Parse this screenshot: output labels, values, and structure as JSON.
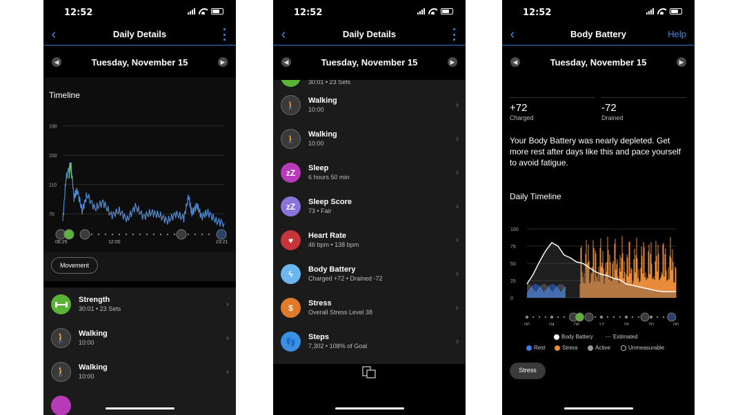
{
  "status": {
    "time": "12:52"
  },
  "screen1": {
    "title": "Daily Details",
    "date": "Tuesday, November 15",
    "section": "Timeline",
    "yticks": [
      "190",
      "150",
      "110",
      "70"
    ],
    "xticks": [
      "06:25",
      "12:00",
      "23:21"
    ],
    "movement_button": "Movement",
    "rows": [
      {
        "title": "Strength",
        "sub": "30:01 • 23 Sets"
      },
      {
        "title": "Walking",
        "sub": "10:00"
      },
      {
        "title": "Walking",
        "sub": "10:00"
      }
    ]
  },
  "screen2": {
    "title": "Daily Details",
    "date": "Tuesday, November 15",
    "partial_sub": "30:01 • 23 Sets",
    "rows": [
      {
        "title": "Walking",
        "sub": "10:00",
        "icon": "walking-icon",
        "color": "#3a3a3a"
      },
      {
        "title": "Walking",
        "sub": "10:00",
        "icon": "walking-icon",
        "color": "#3a3a3a"
      },
      {
        "title": "Sleep",
        "sub": "6 hours 50 min",
        "icon": "sleep-icon",
        "color": "#b83ab8"
      },
      {
        "title": "Sleep Score",
        "sub": "73 • Fair",
        "icon": "sleep-score-icon",
        "color": "#8a74d9"
      },
      {
        "title": "Heart Rate",
        "sub": "46 bpm • 138 bpm",
        "icon": "heart-icon",
        "color": "#c7343a"
      },
      {
        "title": "Body Battery",
        "sub": "Charged +72 • Drained -72",
        "icon": "body-battery-icon",
        "color": "#6cb6f0"
      },
      {
        "title": "Stress",
        "sub": "Overall Stress Level 38",
        "icon": "stress-icon",
        "color": "#e07b2c"
      },
      {
        "title": "Steps",
        "sub": "7,302 • 108% of Goal",
        "icon": "steps-icon",
        "color": "#3b8fe0"
      }
    ]
  },
  "screen3": {
    "title": "Body Battery",
    "help": "Help",
    "date": "Tuesday, November 15",
    "charged_value": "+72",
    "charged_label": "Charged",
    "drained_value": "-72",
    "drained_label": "Drained",
    "message": "Your Body Battery was nearly depleted. Get more rest after days like this and pace yourself to avoid fatigue.",
    "section": "Daily Timeline",
    "legend": {
      "body_battery": "Body Battery",
      "estimated": "Estimated",
      "rest": "Rest",
      "stress": "Stress",
      "active": "Active",
      "unmeasurable": "Unmeasurable"
    },
    "stress_button": "Stress"
  },
  "colors": {
    "accent": "#3d8ee8",
    "rest": "#3b7be0",
    "stress": "#e88b3a",
    "active": "#9a9a9a",
    "hr_line": "#4f8ddb",
    "hr_peak": "#6cc04a"
  },
  "chart_data": [
    {
      "type": "line",
      "title": "Timeline",
      "yticks": [
        70,
        110,
        150,
        190
      ],
      "ylim": [
        40,
        200
      ],
      "xticks": [
        "06:25",
        "12:00",
        "23:21"
      ],
      "series": [
        {
          "x": [
            0,
            0.02,
            0.05,
            0.07,
            0.09,
            0.12,
            0.15,
            0.2,
            0.25,
            0.3,
            0.35,
            0.4,
            0.45,
            0.5,
            0.55,
            0.6,
            0.65,
            0.7,
            0.75,
            0.78,
            0.8,
            0.83,
            0.86,
            0.9,
            0.95,
            1.0
          ],
          "values": [
            60,
            118,
            140,
            92,
            102,
            74,
            96,
            77,
            86,
            68,
            74,
            62,
            80,
            66,
            72,
            68,
            60,
            70,
            64,
            94,
            70,
            82,
            66,
            72,
            60,
            57
          ]
        }
      ]
    },
    {
      "type": "area",
      "title": "Daily Timeline",
      "yticks": [
        0,
        25,
        50,
        75,
        100
      ],
      "ylim": [
        0,
        100
      ],
      "xticks": [
        "00",
        "04",
        "08",
        "12",
        "16",
        "20",
        "00"
      ],
      "series": [
        {
          "name": "Body Battery",
          "x": [
            0,
            1,
            2,
            3,
            4,
            5,
            6,
            7,
            8,
            9,
            10,
            11,
            12,
            13,
            14,
            15,
            16,
            17,
            18,
            19,
            20,
            21,
            22,
            23,
            24
          ],
          "values": [
            20,
            34,
            52,
            68,
            80,
            75,
            62,
            58,
            52,
            50,
            44,
            38,
            34,
            32,
            28,
            26,
            20,
            18,
            16,
            14,
            12,
            10,
            9,
            9,
            9
          ]
        }
      ]
    }
  ]
}
